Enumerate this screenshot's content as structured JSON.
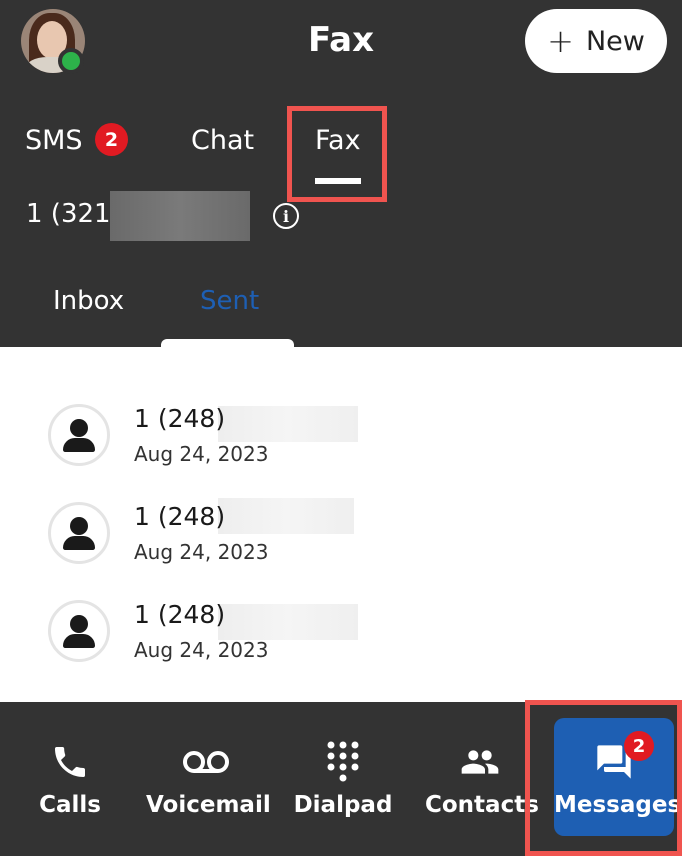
{
  "header": {
    "title": "Fax",
    "new_button_label": "New",
    "new_button_icon": "+"
  },
  "top_tabs": [
    {
      "label": "SMS",
      "badge": "2"
    },
    {
      "label": "Chat"
    },
    {
      "label": "Fax",
      "selected": true
    }
  ],
  "line": {
    "phone_prefix": "1 (321)",
    "info_icon": "i"
  },
  "sub_tabs": [
    {
      "label": "Inbox"
    },
    {
      "label": "Sent",
      "selected": true
    }
  ],
  "faxes": [
    {
      "number": "1 (248)",
      "date": "Aug 24, 2023"
    },
    {
      "number": "1 (248)",
      "date": "Aug 24, 2023"
    },
    {
      "number": "1 (248)",
      "date": "Aug 24, 2023"
    }
  ],
  "bottom_nav": [
    {
      "label": "Calls",
      "icon": "phone-icon"
    },
    {
      "label": "Voicemail",
      "icon": "voicemail-icon"
    },
    {
      "label": "Dialpad",
      "icon": "dialpad-icon"
    },
    {
      "label": "Contacts",
      "icon": "contacts-icon"
    },
    {
      "label": "Messages",
      "icon": "messages-icon",
      "badge": "2",
      "selected": true
    }
  ],
  "colors": {
    "background_dark": "#333333",
    "accent_blue": "#1e5fb3",
    "badge_red": "#e11a22",
    "presence_green": "#2db24a",
    "highlight": "#f0544f"
  }
}
